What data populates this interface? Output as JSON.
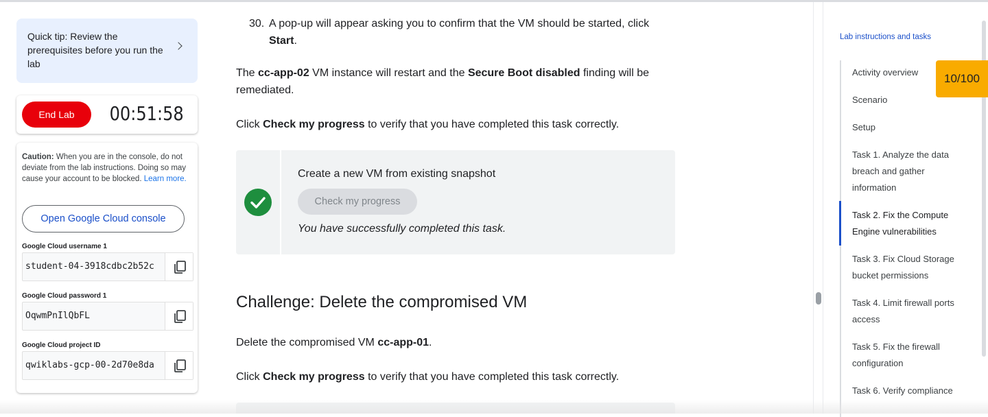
{
  "sidebar": {
    "tip_text": "Quick tip: Review the prerequisites before you run the lab",
    "end_lab_label": "End Lab",
    "timer": "00:51:58",
    "caution_bold": "Caution:",
    "caution_text": " When you are in the console, do not deviate from the lab instructions. Doing so may cause your account to be blocked. ",
    "learn_more": "Learn more.",
    "console_button": "Open Google Cloud console",
    "fields": [
      {
        "label": "Google Cloud username 1",
        "value": "student-04-3918cdbc2b52c"
      },
      {
        "label": "Google Cloud password 1",
        "value": "OqwmPnIlQbFL"
      },
      {
        "label": "Google Cloud project ID",
        "value": "qwiklabs-gcp-00-2d70e8da"
      }
    ]
  },
  "content": {
    "step_number": "30.",
    "step_text_1": "A pop-up will appear asking you to confirm that the VM should be started, click ",
    "step_bold": "Start",
    "step_text_2": ".",
    "restart_t1": "The ",
    "restart_b1": "cc-app-02",
    "restart_t2": " VM instance will restart and the ",
    "restart_b2": "Secure Boot disabled",
    "restart_t3": " finding will be remediated.",
    "click_t1": "Click ",
    "click_b": "Check my progress",
    "click_t2": " to verify that you have completed this task correctly.",
    "task_title": "Create a new VM from existing snapshot",
    "progress_button": "Check my progress",
    "success_text": "You have successfully completed this task.",
    "challenge_heading": "Challenge: Delete the compromised VM",
    "delete_t1": "Delete the compromised VM ",
    "delete_b": "cc-app-01",
    "delete_t2": "."
  },
  "toc": {
    "title": "Lab instructions and tasks",
    "items": [
      "Activity overview",
      "Scenario",
      "Setup",
      "Task 1. Analyze the data breach and gather information",
      "Task 2. Fix the Compute Engine vulnerabilities",
      "Task 3. Fix Cloud Storage bucket permissions",
      "Task 4. Limit firewall ports access",
      "Task 5. Fix the firewall configuration",
      "Task 6. Verify compliance"
    ],
    "active_index": 4
  },
  "score": "10/100",
  "colors": {
    "accent": "#1a4fc9",
    "end_lab": "#e8000b",
    "success": "#1e8e3e",
    "score_badge": "#f9ab00",
    "tip_bg": "#e8f0fe"
  },
  "icons": [
    "chevron-right-icon",
    "copy-icon",
    "checkmark-icon"
  ]
}
